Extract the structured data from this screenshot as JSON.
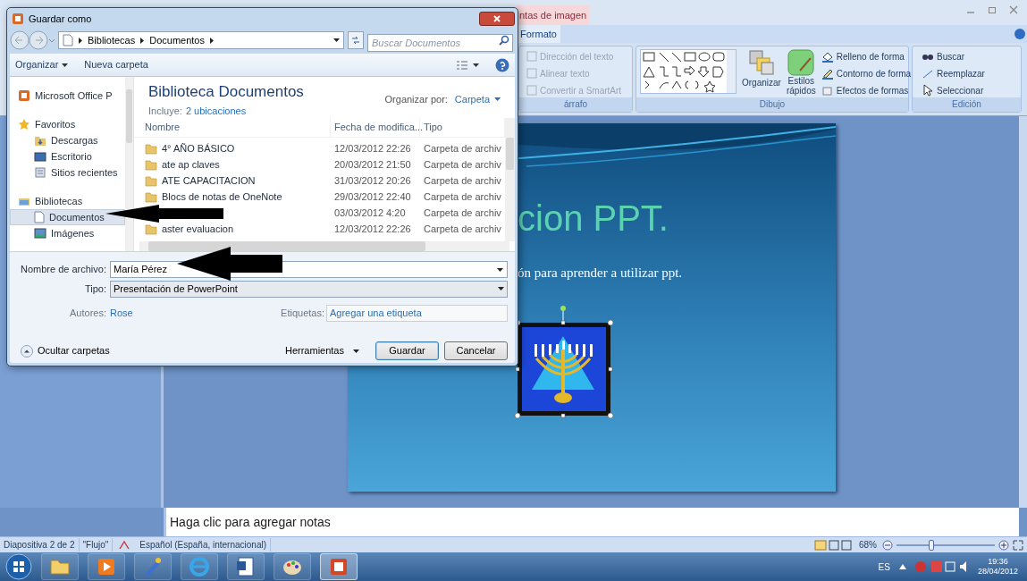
{
  "dialog": {
    "title": "Guardar como",
    "breadcrumb": [
      "Bibliotecas",
      "Documentos"
    ],
    "search": {
      "placeholder": "Buscar Documentos"
    },
    "toolbar": [
      "Organizar",
      "Nueva carpeta"
    ],
    "nav": [
      {
        "kind": "item",
        "label": "Microsoft Office P",
        "selected": false
      },
      {
        "kind": "header",
        "label": "Favoritos",
        "selected": false
      },
      {
        "kind": "child",
        "label": "Descargas",
        "selected": false
      },
      {
        "kind": "child",
        "label": "Escritorio",
        "selected": false
      },
      {
        "kind": "child",
        "label": "Sitios recientes",
        "selected": false
      },
      {
        "kind": "header",
        "label": "Bibliotecas",
        "selected": false
      },
      {
        "kind": "child",
        "label": "Documentos",
        "selected": true
      },
      {
        "kind": "child",
        "label": "Imágenes",
        "selected": false
      }
    ],
    "library": {
      "title": "Biblioteca Documentos",
      "includes_label": "Incluye:",
      "includes_link": "2 ubicaciones",
      "arrange_label": "Organizar por:",
      "arrange_value": "Carpeta"
    },
    "columns": [
      "Nombre",
      "Fecha de modifica...",
      "Tipo"
    ],
    "rows": [
      {
        "name": "4° AÑO BÁSICO",
        "date": "12/03/2012 22:26",
        "type": "Carpeta de archiv"
      },
      {
        "name": "ate ap claves",
        "date": "20/03/2012 21:50",
        "type": "Carpeta de archiv"
      },
      {
        "name": "ATE CAPACITACION",
        "date": "31/03/2012 20:26",
        "type": "Carpeta de archiv"
      },
      {
        "name": "Blocs de notas de OneNote",
        "date": "29/03/2012 22:40",
        "type": "Carpeta de archiv"
      },
      {
        "date": "03/03/2012 4:20",
        "type": "Carpeta de archiv"
      },
      {
        "name": "aster evaluacion",
        "date": "12/03/2012 22:26",
        "type": "Carpeta de archiv"
      }
    ],
    "file_name": {
      "label": "Nombre de archivo:",
      "value": "María Pérez"
    },
    "file_type": {
      "label": "Tipo:",
      "value": "Presentación de PowerPoint"
    },
    "authors": {
      "label": "Autores:",
      "value": "Rose"
    },
    "tags": {
      "label": "Etiquetas:",
      "placeholder": "Agregar una etiqueta"
    },
    "hide_folders": "Ocultar carpetas",
    "tools": "Herramientas",
    "buttons": [
      {
        "label": "Guardar",
        "kind": "default"
      },
      {
        "label": "Cancelar",
        "kind": "normal"
      }
    ]
  },
  "ribbon": {
    "contextual_tab": "ntas de imagen",
    "tab": "Formato",
    "paragraph": {
      "label": "árrafo",
      "items": [
        {
          "label": "Dirección del texto",
          "disabled": true
        },
        {
          "label": "Alinear texto",
          "disabled": true
        },
        {
          "label": "Convertir a SmartArt",
          "disabled": true
        }
      ]
    },
    "drawing": {
      "label": "Dibujo",
      "arrange": "Organizar",
      "styles": [
        "Estilos",
        "rápidos"
      ],
      "items": [
        "Relleno de forma",
        "Contorno de forma",
        "Efectos de formas"
      ]
    },
    "editing": {
      "label": "Edición",
      "items": [
        "Buscar",
        "Reemplazar",
        "Seleccionar"
      ]
    }
  },
  "slide": {
    "title": "cion PPT.",
    "subtitle": "ón para aprender a utilizar ppt."
  },
  "notes": {
    "placeholder": "Haga clic para agregar notas"
  },
  "status_bar": {
    "items": [
      "Diapositiva 2 de 2",
      "\"Flujo\"",
      "Español (España, internacional)"
    ],
    "zoom": "68%",
    "zoom_slider": {
      "level": 0.35
    }
  },
  "tray": {
    "language": "ES",
    "time": "19:36",
    "date": "28/04/2012"
  }
}
